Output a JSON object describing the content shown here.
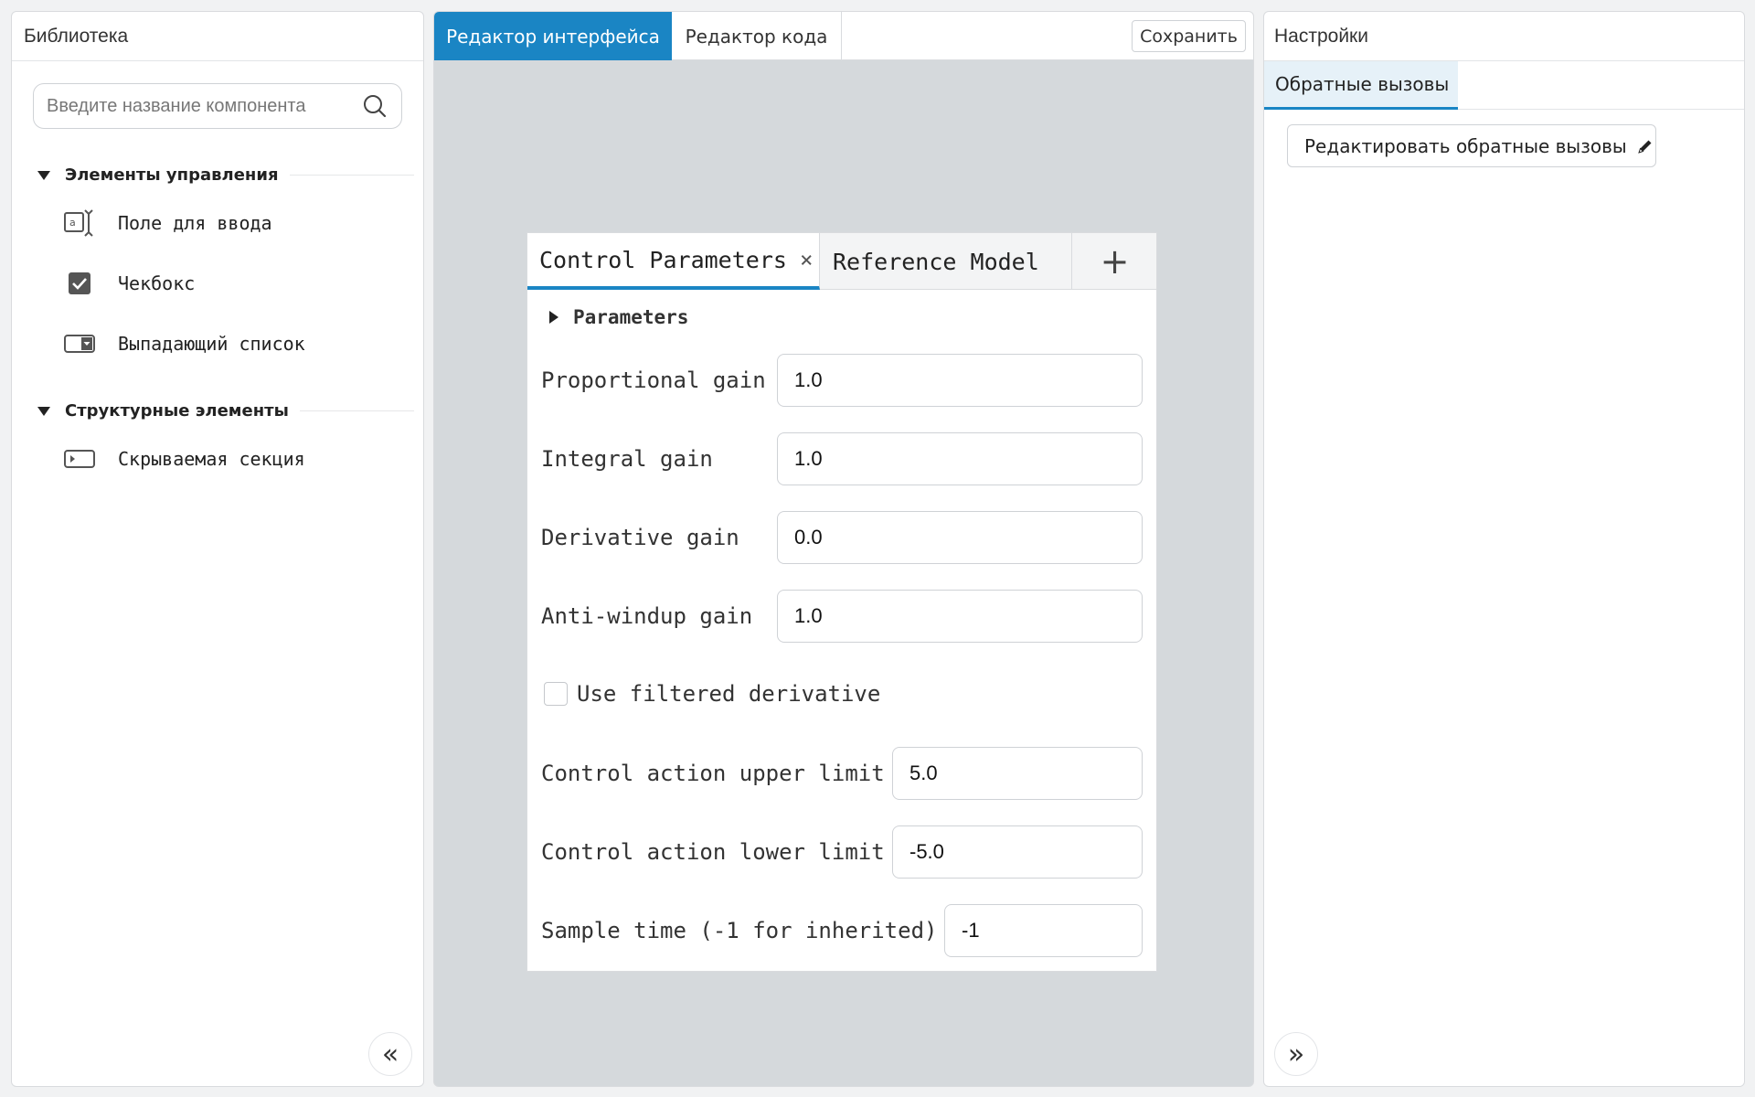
{
  "library": {
    "title": "Библиотека",
    "search_placeholder": "Введите название компонента",
    "groups": [
      {
        "label": "Элементы управления",
        "items": [
          {
            "label": "Поле для ввода",
            "icon": "text-field-icon"
          },
          {
            "label": "Чекбокс",
            "icon": "checkbox-icon"
          },
          {
            "label": "Выпадающий список",
            "icon": "dropdown-icon"
          }
        ]
      },
      {
        "label": "Структурные элементы",
        "items": [
          {
            "label": "Скрываемая секция",
            "icon": "collapsible-section-icon"
          }
        ]
      }
    ],
    "collapse_glyph": "«"
  },
  "editor": {
    "tabs": [
      {
        "label": "Редактор интерфейса",
        "active": true
      },
      {
        "label": "Редактор кода",
        "active": false
      }
    ],
    "save_label": "Сохранить",
    "preview": {
      "tabs": [
        {
          "label": "Control Parameters",
          "active": true,
          "close": "×"
        },
        {
          "label": "Reference Model",
          "active": false
        }
      ],
      "add_tab_glyph": "+",
      "section_title": "Parameters",
      "fields": [
        {
          "label": "Proportional gain",
          "value": "1.0"
        },
        {
          "label": "Integral gain",
          "value": "1.0"
        },
        {
          "label": "Derivative gain",
          "value": "0.0"
        },
        {
          "label": "Anti-windup gain",
          "value": "1.0"
        },
        {
          "label": "Control action upper limit",
          "value": "5.0"
        },
        {
          "label": "Control action lower limit",
          "value": "-5.0"
        },
        {
          "label": "Sample time (-1 for inherited)",
          "value": "-1"
        }
      ],
      "checkbox": {
        "label": "Use filtered derivative",
        "checked": false
      }
    }
  },
  "settings": {
    "title": "Настройки",
    "tab_label": "Обратные вызовы",
    "edit_callbacks_label": "Редактировать обратные вызовы",
    "edit_icon": "pencil-icon",
    "expand_glyph": "»"
  },
  "colors": {
    "accent": "#1a85c4",
    "canvas": "#d5d9dc"
  }
}
